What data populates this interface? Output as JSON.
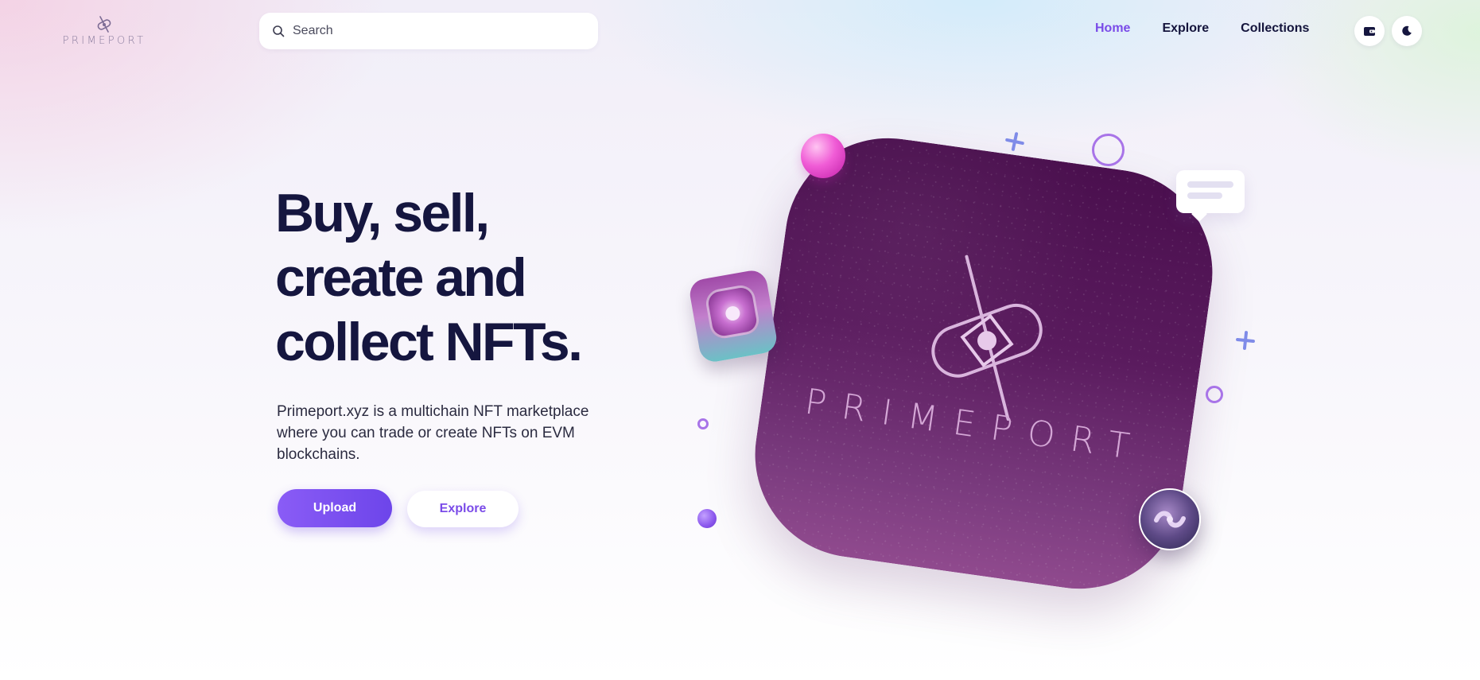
{
  "header": {
    "logo_text": "PRIMEPORT",
    "search": {
      "placeholder": "Search",
      "value": ""
    },
    "nav": [
      {
        "label": "Home",
        "active": true
      },
      {
        "label": "Explore",
        "active": false
      },
      {
        "label": "Collections",
        "active": false
      }
    ],
    "icons": {
      "wallet": "wallet-icon",
      "theme": "moon-icon"
    }
  },
  "hero": {
    "title_lines": [
      "Buy, sell,",
      "create and",
      "collect NFTs."
    ],
    "description": "Primeport.xyz is a multichain NFT marketplace where you can trade or create NFTs on EVM blockchains.",
    "buttons": {
      "upload": "Upload",
      "explore": "Explore"
    },
    "artwork_brand": "PRIMEPORT"
  },
  "colors": {
    "accent": "#7a4be8",
    "heading": "#15163f",
    "card": "#4a0f4e",
    "card_text": "#d4a7d6"
  }
}
